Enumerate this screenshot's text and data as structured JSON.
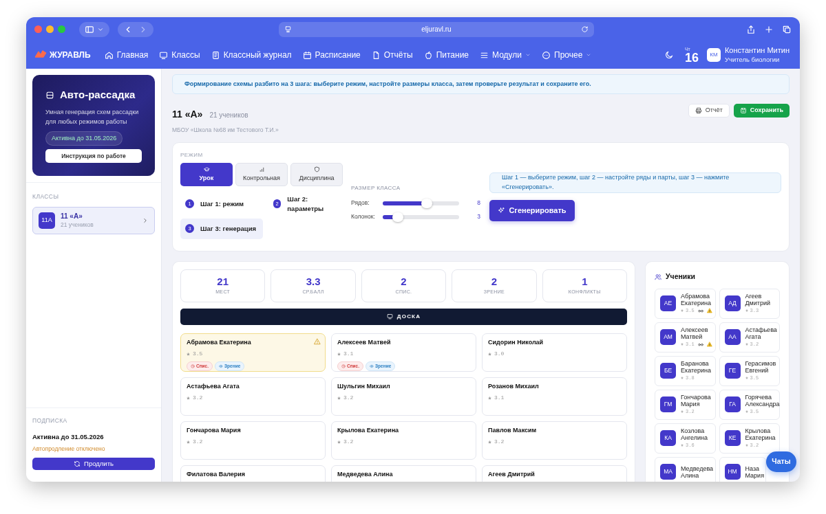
{
  "browser": {
    "url": "eljuravl.ru"
  },
  "nav": {
    "logo": "ЖУРАВЛЬ",
    "items": [
      {
        "label": "Главная",
        "dropdown": false
      },
      {
        "label": "Классы",
        "dropdown": false
      },
      {
        "label": "Классный журнал",
        "dropdown": false
      },
      {
        "label": "Расписание",
        "dropdown": false
      },
      {
        "label": "Отчёты",
        "dropdown": false
      },
      {
        "label": "Питание",
        "dropdown": false
      },
      {
        "label": "Модули",
        "dropdown": true
      },
      {
        "label": "Прочее",
        "dropdown": true
      }
    ],
    "weekday": "Чт",
    "day": "16",
    "user": {
      "initials": "КМ",
      "name": "Константин Митин",
      "role": "Учитель биологии"
    }
  },
  "sidebar": {
    "promo": {
      "title": "Авто-рассадка",
      "description": "Умная генерация схем рассадки для любых режимов работы",
      "badge": "Активна до 31.05.2026",
      "button": "Инструкция по работе"
    },
    "classes_heading": "КЛАССЫ",
    "classes": [
      {
        "code": "11А",
        "name": "11 «А»",
        "count": "21 учеников",
        "selected": true
      }
    ],
    "subscription": {
      "heading": "ПОДПИСКА",
      "status": "Активна до 31.05.2026",
      "autorenew": "Автопродление отключено",
      "button": "Продлить"
    }
  },
  "banner": "Формирование схемы разбито на 3 шага: выберите режим, настройте размеры класса, затем проверьте результат и сохраните его.",
  "header": {
    "title": "11 «А»",
    "count": "21 учеников",
    "school": "МБОУ «Школа №68 им Тестового Т.И.»",
    "buttons": [
      {
        "kind": "report",
        "label": "Отчёт"
      },
      {
        "kind": "save",
        "label": "Сохранить"
      }
    ]
  },
  "mode": {
    "heading": "РЕЖИМ",
    "tabs": [
      {
        "kind": "lesson",
        "label": "Урок",
        "selected": true
      },
      {
        "kind": "test",
        "label": "Контрольная",
        "selected": false
      },
      {
        "kind": "discipline",
        "label": "Дисциплина",
        "selected": false
      }
    ],
    "steps": [
      {
        "number": "1",
        "label": "Шаг 1: режим",
        "selected": false
      },
      {
        "number": "2",
        "label": "Шаг 2: параметры",
        "selected": false
      },
      {
        "number": "3",
        "label": "Шаг 3: генерация",
        "selected": true
      }
    ],
    "size_heading": "РАЗМЕР КЛАССА",
    "sliders": [
      {
        "label": "Рядов:",
        "level": 0.58,
        "reading": "8"
      },
      {
        "label": "Колонок:",
        "level": 0.2,
        "reading": "3"
      }
    ],
    "hint": "Шаг 1 — выберите режим, шаг 2 — настройте ряды и парты, шаг 3 — нажмите «Сгенерировать».",
    "generate_button": "Сгенерировать"
  },
  "stats": [
    {
      "value": "21",
      "label": "МЕСТ"
    },
    {
      "value": "3.3",
      "label": "СР.БАЛЛ"
    },
    {
      "value": "2",
      "label": "СПИС."
    },
    {
      "value": "2",
      "label": "ЗРЕНИЕ"
    },
    {
      "value": "1",
      "label": "КОНФЛИКТЫ"
    }
  ],
  "board": "ДОСКА",
  "seats": [
    {
      "name": "Абрамова Екатерина",
      "rating": "3.5",
      "conflict": true,
      "tags": [
        {
          "kind": "cheat",
          "label": "Спис."
        },
        {
          "kind": "vision",
          "label": "Зрение"
        }
      ]
    },
    {
      "name": "Алексеев Матвей",
      "rating": "3.1",
      "conflict": false,
      "tags": [
        {
          "kind": "cheat",
          "label": "Спис."
        },
        {
          "kind": "vision",
          "label": "Зрение"
        }
      ]
    },
    {
      "name": "Сидорин Николай",
      "rating": "3.0",
      "conflict": false
    },
    {
      "name": "Астафьева Агата",
      "rating": "3.2",
      "conflict": false
    },
    {
      "name": "Шульгин Михаил",
      "rating": "3.2",
      "conflict": false
    },
    {
      "name": "Розанов Михаил",
      "rating": "3.1",
      "conflict": false
    },
    {
      "name": "Гончарова Мария",
      "rating": "3.2",
      "conflict": false
    },
    {
      "name": "Крылова Екатерина",
      "rating": "3.2",
      "conflict": false
    },
    {
      "name": "Павлов Максим",
      "rating": "3.2",
      "conflict": false
    },
    {
      "name": "Филатова Валерия",
      "conflict": false
    },
    {
      "name": "Медведева Алина",
      "conflict": false
    },
    {
      "name": "Агеев Дмитрий",
      "conflict": false
    }
  ],
  "students": {
    "title": "Ученики",
    "items": [
      {
        "initials": "АЕ",
        "name": "Абрамова Екатерина",
        "rating": "3.5",
        "vision": true,
        "conflict": true
      },
      {
        "initials": "АД",
        "name": "Агеев Дмитрий",
        "rating": "3.3",
        "vision": false,
        "conflict": false
      },
      {
        "initials": "АМ",
        "name": "Алексеев Матвей",
        "rating": "3.1",
        "vision": true,
        "conflict": true
      },
      {
        "initials": "АА",
        "name": "Астафьева Агата",
        "rating": "3.2",
        "vision": false,
        "conflict": false
      },
      {
        "initials": "БЕ",
        "name": "Баранова Екатерина",
        "rating": "3.8",
        "vision": false,
        "conflict": false
      },
      {
        "initials": "ГЕ",
        "name": "Герасимов Евгений",
        "rating": "3.5",
        "vision": false,
        "conflict": false
      },
      {
        "initials": "ГМ",
        "name": "Гончарова Мария",
        "rating": "3.2",
        "vision": false,
        "conflict": false
      },
      {
        "initials": "ГА",
        "name": "Горячева Александра",
        "rating": "3.5",
        "vision": false,
        "conflict": false
      },
      {
        "initials": "КА",
        "name": "Козлова Ангелина",
        "rating": "3.6",
        "vision": false,
        "conflict": false
      },
      {
        "initials": "КЕ",
        "name": "Крылова Екатерина",
        "rating": "3.2",
        "vision": false,
        "conflict": false
      },
      {
        "initials": "МА",
        "name": "Медведева Алина",
        "vision": false,
        "conflict": false
      },
      {
        "initials": "НМ",
        "name": "Наза Мария",
        "vision": false,
        "conflict": false
      }
    ]
  },
  "chat_button": "Чаты"
}
